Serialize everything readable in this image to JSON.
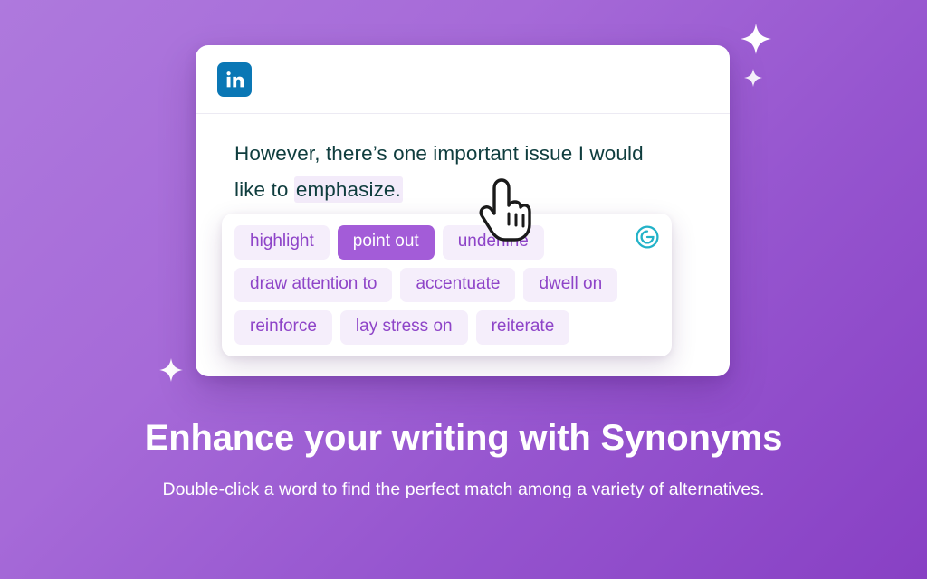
{
  "background": {
    "gradient_from": "#ae79dd",
    "gradient_to": "#8840c4"
  },
  "card": {
    "app_icon": "linkedin-icon",
    "app_name": "LinkedIn",
    "document": {
      "text_before": "However, there’s one important issue I would like to ",
      "highlighted_word": "emphasize.",
      "text_color": "#0f3d3e",
      "highlight_color": "#f3ebfa"
    }
  },
  "synonyms_panel": {
    "brand_icon": "grammarly-icon",
    "brand_color": "#22b2c8",
    "selected_chip_color": "#a35cd8",
    "chip_color": "#f5eefb",
    "chip_text_color": "#8e44c8",
    "rows": [
      [
        {
          "label": "highlight",
          "selected": false
        },
        {
          "label": "point out",
          "selected": true
        },
        {
          "label": "underline",
          "selected": false
        }
      ],
      [
        {
          "label": "draw attention to",
          "selected": false
        },
        {
          "label": "accentuate",
          "selected": false
        },
        {
          "label": "dwell on",
          "selected": false
        }
      ],
      [
        {
          "label": "reinforce",
          "selected": false
        },
        {
          "label": "lay stress on",
          "selected": false
        },
        {
          "label": "reiterate",
          "selected": false
        }
      ]
    ]
  },
  "cursor": {
    "type": "pointing-hand-cursor"
  },
  "caption": {
    "title": "Enhance your writing with Synonyms",
    "subtitle": "Double-click a word to find the perfect match among a variety of alternatives."
  },
  "decorations": {
    "sparkles": [
      {
        "name": "sparkle-top-large",
        "size": 34
      },
      {
        "name": "sparkle-top-small",
        "size": 20
      },
      {
        "name": "sparkle-bottom-left",
        "size": 26
      }
    ]
  }
}
